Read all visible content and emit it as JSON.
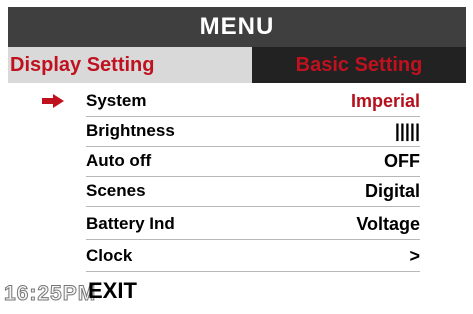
{
  "header": {
    "title": "MENU"
  },
  "tabs": [
    {
      "label": "Display Setting",
      "active": true
    },
    {
      "label": "Basic Setting",
      "active": false
    }
  ],
  "selected_row": 0,
  "rows": [
    {
      "label": "System",
      "value": "Imperial"
    },
    {
      "label": "Brightness",
      "value": "|||||"
    },
    {
      "label": "Auto off",
      "value": "OFF"
    },
    {
      "label": "Scenes",
      "value": "Digital"
    },
    {
      "label": "Battery Ind",
      "value": "Voltage"
    },
    {
      "label": "Clock",
      "value": ">"
    }
  ],
  "exit_label": "EXIT",
  "time": "16:25PM",
  "icons": {
    "selector": "right-arrow-icon"
  },
  "colors": {
    "accent": "#c0111f",
    "header_bg": "#3f3f3f",
    "active_tab_bg": "#d9d9d9",
    "inactive_tab_bg": "#222222"
  }
}
